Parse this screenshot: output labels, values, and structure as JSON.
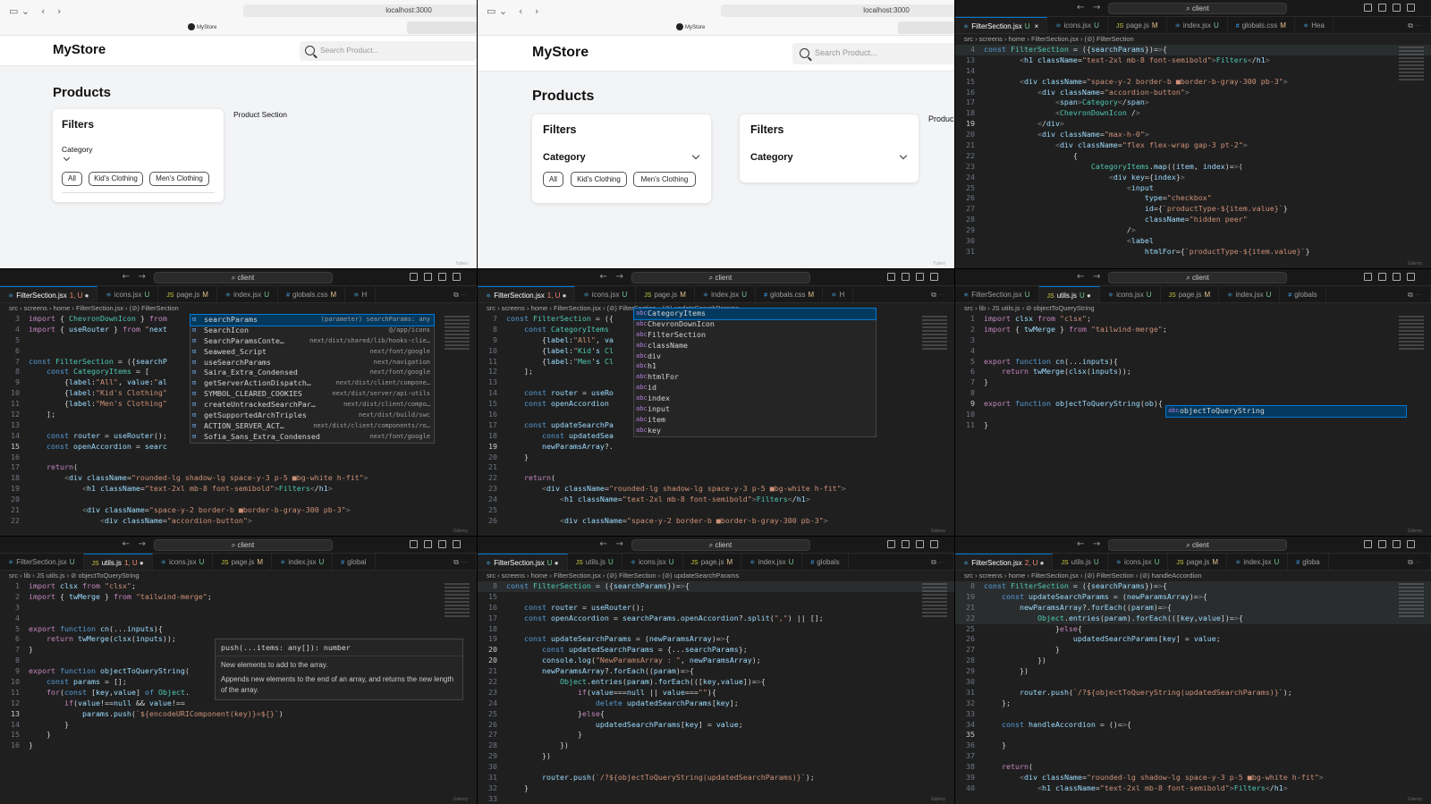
{
  "browser_left": {
    "url": "localhost:3000",
    "tab_title": "MyStore",
    "store_name": "MyStore",
    "search_placeholder": "Search Product...",
    "page_heading": "Products",
    "filters_heading": "Filters",
    "category_label": "Category",
    "chips": [
      "All",
      "Kid's Clothing",
      "Men's Clothing"
    ],
    "product_section": "Product Section",
    "watermark": "Tubeo"
  },
  "browser_right": {
    "url": "localhost:3000",
    "tab_title": "MyStore",
    "store_name": "MyStore",
    "search_placeholder": "Search Product...",
    "page_heading": "Products",
    "filters_heading": "Filters",
    "category_label": "Category",
    "chips": [
      "All",
      "Kid's Clothing",
      "Men's Clothing"
    ],
    "filters_heading_2": "Filters",
    "category_label_2": "Category",
    "product_section": "Produc",
    "watermark": "Tubeo"
  },
  "editor_command": "client",
  "editor_watermark": "Gdemy",
  "panel_c": {
    "tabs": [
      {
        "name": "FilterSection.jsx",
        "status": "U",
        "icon": "react-icon",
        "active": true,
        "close": "×"
      },
      {
        "name": "icons.jsx",
        "status": "U",
        "icon": "react-icon"
      },
      {
        "name": "page.js",
        "status": "M",
        "icon": "js-icon"
      },
      {
        "name": "index.jsx",
        "status": "U",
        "icon": "react-icon"
      },
      {
        "name": "globals.css",
        "status": "M",
        "icon": "css-icon"
      },
      {
        "name": "Hea",
        "status": "",
        "icon": "react-icon"
      }
    ],
    "breadcrumb": "src › screens › home › FilterSection.jsx › (⊘) FilterSection",
    "sticky": {
      "n": "4",
      "t": "const FilterSection = ({searchParams})=>{"
    },
    "lines": [
      {
        "n": "13",
        "t": "        <h1 className=\"text-2xl mb-8 font-semibold\">Filters</h1>"
      },
      {
        "n": "14",
        "t": ""
      },
      {
        "n": "15",
        "t": "        <div className=\"space-y-2 border-b ■border-b-gray-300 pb-3\">"
      },
      {
        "n": "16",
        "t": "            <div className=\"accordion-button\">"
      },
      {
        "n": "17",
        "t": "                <span>Category</span>"
      },
      {
        "n": "18",
        "t": "                <ChevronDownIcon />"
      },
      {
        "n": "19",
        "t": "            </div>"
      },
      {
        "n": "20",
        "t": "            <div className=\"max-h-0\">"
      },
      {
        "n": "21",
        "t": "                <div className=\"flex flex-wrap gap-3 pt-2\">"
      },
      {
        "n": "22",
        "t": "                    {"
      },
      {
        "n": "23",
        "t": "                        CategoryItems.map((item, index)=>("
      },
      {
        "n": "24",
        "t": "                            <div key={index}>"
      },
      {
        "n": "25",
        "t": "                                <input"
      },
      {
        "n": "26",
        "t": "                                    type=\"checkbox\""
      },
      {
        "n": "27",
        "t": "                                    id={`productType-${item.value}`}"
      },
      {
        "n": "28",
        "t": "                                    className=\"hidden peer\""
      },
      {
        "n": "29",
        "t": "                                />"
      },
      {
        "n": "30",
        "t": "                                <label"
      },
      {
        "n": "31",
        "t": "                                    htmlFor={`productType-${item.value}`}"
      }
    ],
    "current_line": "19"
  },
  "panel_d": {
    "tabs": [
      {
        "name": "FilterSection.jsx",
        "status": "1, U",
        "icon": "react-icon",
        "active": true,
        "dirty": true
      },
      {
        "name": "icons.jsx",
        "status": "U",
        "icon": "react-icon"
      },
      {
        "name": "page.js",
        "status": "M",
        "icon": "js-icon"
      },
      {
        "name": "index.jsx",
        "status": "U",
        "icon": "react-icon"
      },
      {
        "name": "globals.css",
        "status": "M",
        "icon": "css-icon"
      },
      {
        "name": "H",
        "status": "",
        "icon": "react-icon"
      }
    ],
    "breadcrumb": "src › screens › home › FilterSection.jsx › (⊘) FilterSection",
    "lines": [
      {
        "n": "3",
        "t": "import { ChevronDownIcon } from"
      },
      {
        "n": "4",
        "t": "import { useRouter } from \"next"
      },
      {
        "n": "5",
        "t": ""
      },
      {
        "n": "6",
        "t": ""
      },
      {
        "n": "7",
        "t": "const FilterSection = ({searchP"
      },
      {
        "n": "8",
        "t": "    const CategoryItems = ["
      },
      {
        "n": "9",
        "t": "        {label:\"All\", value:\"al"
      },
      {
        "n": "10",
        "t": "        {label:\"Kid's Clothing\""
      },
      {
        "n": "11",
        "t": "        {label:\"Men's Clothing\""
      },
      {
        "n": "12",
        "t": "    ];"
      },
      {
        "n": "13",
        "t": ""
      },
      {
        "n": "14",
        "t": "    const router = useRouter();"
      },
      {
        "n": "15",
        "t": "    const openAccordion = searc"
      },
      {
        "n": "16",
        "t": ""
      },
      {
        "n": "17",
        "t": "    return("
      },
      {
        "n": "18",
        "t": "        <div className=\"rounded-lg shadow-lg space-y-3 p-5 ■bg-white h-fit\">"
      },
      {
        "n": "19",
        "t": "            <h1 className=\"text-2xl mb-8 font-semibold\">Filters</h1>"
      },
      {
        "n": "20",
        "t": ""
      },
      {
        "n": "21",
        "t": "            <div className=\"space-y-2 border-b ■border-b-gray-300 pb-3\">"
      },
      {
        "n": "22",
        "t": "                <div className=\"accordion-button\">"
      }
    ],
    "current_line": "15",
    "suggestions": [
      {
        "label": "searchParams",
        "detail": "(parameter) searchParams: any",
        "kind": "var"
      },
      {
        "label": "SearchIcon",
        "detail": "@/app/icons",
        "kind": "var"
      },
      {
        "label": "SearchParamsConte…",
        "detail": "next/dist/shared/lib/hooks-clie…",
        "kind": "var"
      },
      {
        "label": "Seaweed_Script",
        "detail": "next/font/google",
        "kind": "var"
      },
      {
        "label": "useSearchParams",
        "detail": "next/navigation",
        "kind": "var"
      },
      {
        "label": "Saira_Extra_Condensed",
        "detail": "next/font/google",
        "kind": "var"
      },
      {
        "label": "getServerActionDispatch…",
        "detail": "next/dist/client/compone…",
        "kind": "var"
      },
      {
        "label": "SYMBOL_CLEARED_COOKIES",
        "detail": "next/dist/server/api-utils",
        "kind": "var"
      },
      {
        "label": "createUntrackedSearchPar…",
        "detail": "next/dist/client/compo…",
        "kind": "var"
      },
      {
        "label": "getSupportedArchTriples",
        "detail": "next/dist/build/swc",
        "kind": "var"
      },
      {
        "label": "ACTION_SERVER_ACT…",
        "detail": "next/dist/client/components/ro…",
        "kind": "var"
      },
      {
        "label": "Sofia_Sans_Extra_Condensed",
        "detail": "next/font/google",
        "kind": "var"
      }
    ]
  },
  "panel_e": {
    "tabs": [
      {
        "name": "FilterSection.jsx",
        "status": "1, U",
        "icon": "react-icon",
        "active": true,
        "dirty": true
      },
      {
        "name": "icons.jsx",
        "status": "U",
        "icon": "react-icon"
      },
      {
        "name": "page.js",
        "status": "M",
        "icon": "js-icon"
      },
      {
        "name": "index.jsx",
        "status": "U",
        "icon": "react-icon"
      },
      {
        "name": "globals.css",
        "status": "M",
        "icon": "css-icon"
      },
      {
        "name": "H",
        "status": "",
        "icon": "react-icon"
      }
    ],
    "breadcrumb": "src › screens › home › FilterSection.jsx › (⊘) FilterSection › (⊘) updateSearchParams",
    "lines": [
      {
        "n": "7",
        "t": "const FilterSection = ({"
      },
      {
        "n": "8",
        "t": "    const CategoryItems"
      },
      {
        "n": "9",
        "t": "        {label:\"All\", va"
      },
      {
        "n": "10",
        "t": "        {label:\"Kid's Cl"
      },
      {
        "n": "11",
        "t": "        {label:\"Men's Cl"
      },
      {
        "n": "12",
        "t": "    ];"
      },
      {
        "n": "13",
        "t": ""
      },
      {
        "n": "14",
        "t": "    const router = useRo"
      },
      {
        "n": "15",
        "t": "    const openAccordion"
      },
      {
        "n": "16",
        "t": ""
      },
      {
        "n": "17",
        "t": "    const updateSearchPa"
      },
      {
        "n": "18",
        "t": "        const updatedSea"
      },
      {
        "n": "19",
        "t": "        newParamsArray?."
      },
      {
        "n": "20",
        "t": "    }"
      },
      {
        "n": "21",
        "t": ""
      },
      {
        "n": "22",
        "t": "    return("
      },
      {
        "n": "23",
        "t": "        <div className=\"rounded-lg shadow-lg space-y-3 p-5 ■bg-white h-fit\">"
      },
      {
        "n": "24",
        "t": "            <h1 className=\"text-2xl mb-8 font-semibold\">Filters</h1>"
      },
      {
        "n": "25",
        "t": ""
      },
      {
        "n": "26",
        "t": "            <div className=\"space-y-2 border-b ■border-b-gray-300 pb-3\">"
      }
    ],
    "current_line": "19",
    "suggestions": [
      {
        "label": "CategoryItems",
        "detail": "",
        "kind": "word"
      },
      {
        "label": "ChevronDownIcon",
        "detail": "",
        "kind": "word"
      },
      {
        "label": "FilterSection",
        "detail": "",
        "kind": "word"
      },
      {
        "label": "className",
        "detail": "",
        "kind": "word"
      },
      {
        "label": "div",
        "detail": "",
        "kind": "word"
      },
      {
        "label": "h1",
        "detail": "",
        "kind": "word"
      },
      {
        "label": "htmlFor",
        "detail": "",
        "kind": "word"
      },
      {
        "label": "id",
        "detail": "",
        "kind": "word"
      },
      {
        "label": "index",
        "detail": "",
        "kind": "word"
      },
      {
        "label": "input",
        "detail": "",
        "kind": "word"
      },
      {
        "label": "item",
        "detail": "",
        "kind": "word"
      },
      {
        "label": "key",
        "detail": "",
        "kind": "word"
      }
    ]
  },
  "panel_f": {
    "tabs": [
      {
        "name": "FilterSection.jsx",
        "status": "U",
        "icon": "react-icon"
      },
      {
        "name": "utils.js",
        "status": "U",
        "icon": "js-icon",
        "active": true,
        "dirty": true
      },
      {
        "name": "icons.jsx",
        "status": "U",
        "icon": "react-icon"
      },
      {
        "name": "page.js",
        "status": "M",
        "icon": "js-icon"
      },
      {
        "name": "index.jsx",
        "status": "U",
        "icon": "react-icon"
      },
      {
        "name": "globals",
        "status": "",
        "icon": "css-icon"
      }
    ],
    "breadcrumb": "src › lib › JS utils.js › ⊘ objectToQueryString",
    "lines": [
      {
        "n": "1",
        "t": "import clsx from \"clsx\";"
      },
      {
        "n": "2",
        "t": "import { twMerge } from \"tailwind-merge\";"
      },
      {
        "n": "3",
        "t": ""
      },
      {
        "n": "4",
        "t": ""
      },
      {
        "n": "5",
        "t": "export function cn(...inputs){"
      },
      {
        "n": "6",
        "t": "    return twMerge(clsx(inputs));"
      },
      {
        "n": "7",
        "t": "}"
      },
      {
        "n": "8",
        "t": ""
      },
      {
        "n": "9",
        "t": "export function objectToQueryString(ob){"
      },
      {
        "n": "10",
        "t": ""
      },
      {
        "n": "11",
        "t": "}"
      }
    ],
    "current_line": "9",
    "suggestions": [
      {
        "label": "objectToQueryString",
        "detail": "",
        "kind": "word"
      }
    ]
  },
  "panel_g": {
    "tabs": [
      {
        "name": "FilterSection.jsx",
        "status": "U",
        "icon": "react-icon"
      },
      {
        "name": "utils.js",
        "status": "1, U",
        "icon": "js-icon",
        "active": true,
        "dirty": true
      },
      {
        "name": "icons.jsx",
        "status": "U",
        "icon": "react-icon"
      },
      {
        "name": "page.js",
        "status": "M",
        "icon": "js-icon"
      },
      {
        "name": "index.jsx",
        "status": "U",
        "icon": "react-icon"
      },
      {
        "name": "global",
        "status": "",
        "icon": "css-icon"
      }
    ],
    "breadcrumb": "src › lib › JS utils.js › ⊘ objectToQueryString",
    "lines": [
      {
        "n": "1",
        "t": "import clsx from \"clsx\";"
      },
      {
        "n": "2",
        "t": "import { twMerge } from \"tailwind-merge\";"
      },
      {
        "n": "3",
        "t": ""
      },
      {
        "n": "4",
        "t": ""
      },
      {
        "n": "5",
        "t": "export function cn(...inputs){"
      },
      {
        "n": "6",
        "t": "    return twMerge(clsx(inputs));"
      },
      {
        "n": "7",
        "t": "}"
      },
      {
        "n": "8",
        "t": ""
      },
      {
        "n": "9",
        "t": "export function objectToQueryString("
      },
      {
        "n": "10",
        "t": "    const params = [];"
      },
      {
        "n": "11",
        "t": "    for(const [key,value] of Object."
      },
      {
        "n": "12",
        "t": "        if(value!==null && value!=="
      },
      {
        "n": "13",
        "t": "            params.push(`${encodeURIComponent(key)}=${}`)"
      },
      {
        "n": "14",
        "t": "        }"
      },
      {
        "n": "15",
        "t": "    }"
      },
      {
        "n": "16",
        "t": "}"
      }
    ],
    "current_line": "13",
    "hover_signature": "push(...items: any[]): number",
    "hover_doc_1": "New elements to add to the array.",
    "hover_doc_2": "Appends new elements to the end of an array, and returns the new length of the array."
  },
  "panel_h": {
    "tabs": [
      {
        "name": "FilterSection.jsx",
        "status": "U",
        "icon": "react-icon",
        "active": true,
        "dirty": true
      },
      {
        "name": "utils.js",
        "status": "U",
        "icon": "js-icon"
      },
      {
        "name": "icons.jsx",
        "status": "U",
        "icon": "react-icon"
      },
      {
        "name": "page.js",
        "status": "M",
        "icon": "js-icon"
      },
      {
        "name": "index.jsx",
        "status": "U",
        "icon": "react-icon"
      },
      {
        "name": "globals",
        "status": "",
        "icon": "css-icon"
      }
    ],
    "breadcrumb": "src › screens › home › FilterSection.jsx › (⊘) FilterSection › (⊘) updateSearchParams",
    "sticky": {
      "n": "8",
      "t": "const FilterSection = ({searchParams})=>{"
    },
    "lines": [
      {
        "n": "15",
        "t": ""
      },
      {
        "n": "16",
        "t": "    const router = useRouter();"
      },
      {
        "n": "17",
        "t": "    const openAccordion = searchParams.openAccordion?.split(\",\") || [];"
      },
      {
        "n": "18",
        "t": ""
      },
      {
        "n": "19",
        "t": "    const updateSearchParams = (newParamsArray)=>{"
      },
      {
        "n": "20",
        "t": "        const updatedSearchParams = {...searchParams};"
      },
      {
        "n": "20",
        "t": "        console.log(\"NewParamsArray : \", newParamsArray);"
      },
      {
        "n": "21",
        "t": "        newParamsArray?.forEach((param)=>{"
      },
      {
        "n": "22",
        "t": "            Object.entries(param).forEach(([key,value])=>{"
      },
      {
        "n": "23",
        "t": "                if(value===null || value===\"\"){"
      },
      {
        "n": "24",
        "t": "                    delete updatedSearchParams[key];"
      },
      {
        "n": "25",
        "t": "                }else{"
      },
      {
        "n": "26",
        "t": "                    updatedSearchParams[key] = value;"
      },
      {
        "n": "27",
        "t": "                }"
      },
      {
        "n": "28",
        "t": "            })"
      },
      {
        "n": "29",
        "t": "        })"
      },
      {
        "n": "30",
        "t": ""
      },
      {
        "n": "31",
        "t": "        router.push(`/?${objectToQueryString(updatedSearchParams)}`);"
      },
      {
        "n": "32",
        "t": "    }"
      },
      {
        "n": "33",
        "t": ""
      }
    ],
    "current_line": "20"
  },
  "panel_i": {
    "tabs": [
      {
        "name": "FilterSection.jsx",
        "status": "2, U",
        "icon": "react-icon",
        "active": true,
        "dirty": true
      },
      {
        "name": "utils.js",
        "status": "U",
        "icon": "js-icon"
      },
      {
        "name": "icons.jsx",
        "status": "U",
        "icon": "react-icon"
      },
      {
        "name": "page.js",
        "status": "M",
        "icon": "js-icon"
      },
      {
        "name": "index.jsx",
        "status": "U",
        "icon": "react-icon"
      },
      {
        "name": "globa",
        "status": "",
        "icon": "css-icon"
      }
    ],
    "breadcrumb": "src › screens › home › FilterSection.jsx › (⊘) FilterSection › (⊘) handleAccordion",
    "sticky_lines": [
      {
        "n": "8",
        "t": "const FilterSection = ({searchParams})=>{"
      },
      {
        "n": "19",
        "t": "    const updateSearchParams = (newParamsArray)=>{"
      },
      {
        "n": "21",
        "t": "        newParamsArray?.forEach((param)=>{"
      },
      {
        "n": "22",
        "t": "            Object.entries(param).forEach(([key,value])=>{"
      }
    ],
    "lines": [
      {
        "n": "25",
        "t": "                }else{"
      },
      {
        "n": "26",
        "t": "                    updatedSearchParams[key] = value;"
      },
      {
        "n": "27",
        "t": "                }"
      },
      {
        "n": "28",
        "t": "            })"
      },
      {
        "n": "29",
        "t": "        })"
      },
      {
        "n": "30",
        "t": ""
      },
      {
        "n": "31",
        "t": "        router.push(`/?${objectToQueryString(updatedSearchParams)}`);"
      },
      {
        "n": "32",
        "t": "    };"
      },
      {
        "n": "33",
        "t": ""
      },
      {
        "n": "34",
        "t": "    const handleAccordion = ()=>{"
      },
      {
        "n": "35",
        "t": "        "
      },
      {
        "n": "36",
        "t": "    }"
      },
      {
        "n": "37",
        "t": ""
      },
      {
        "n": "38",
        "t": "    return("
      },
      {
        "n": "39",
        "t": "        <div className=\"rounded-lg shadow-lg space-y-3 p-5 ■bg-white h-fit\">"
      },
      {
        "n": "40",
        "t": "            <h1 className=\"text-2xl mb-8 font-semibold\">Filters</h1>"
      }
    ],
    "current_line": "35"
  }
}
